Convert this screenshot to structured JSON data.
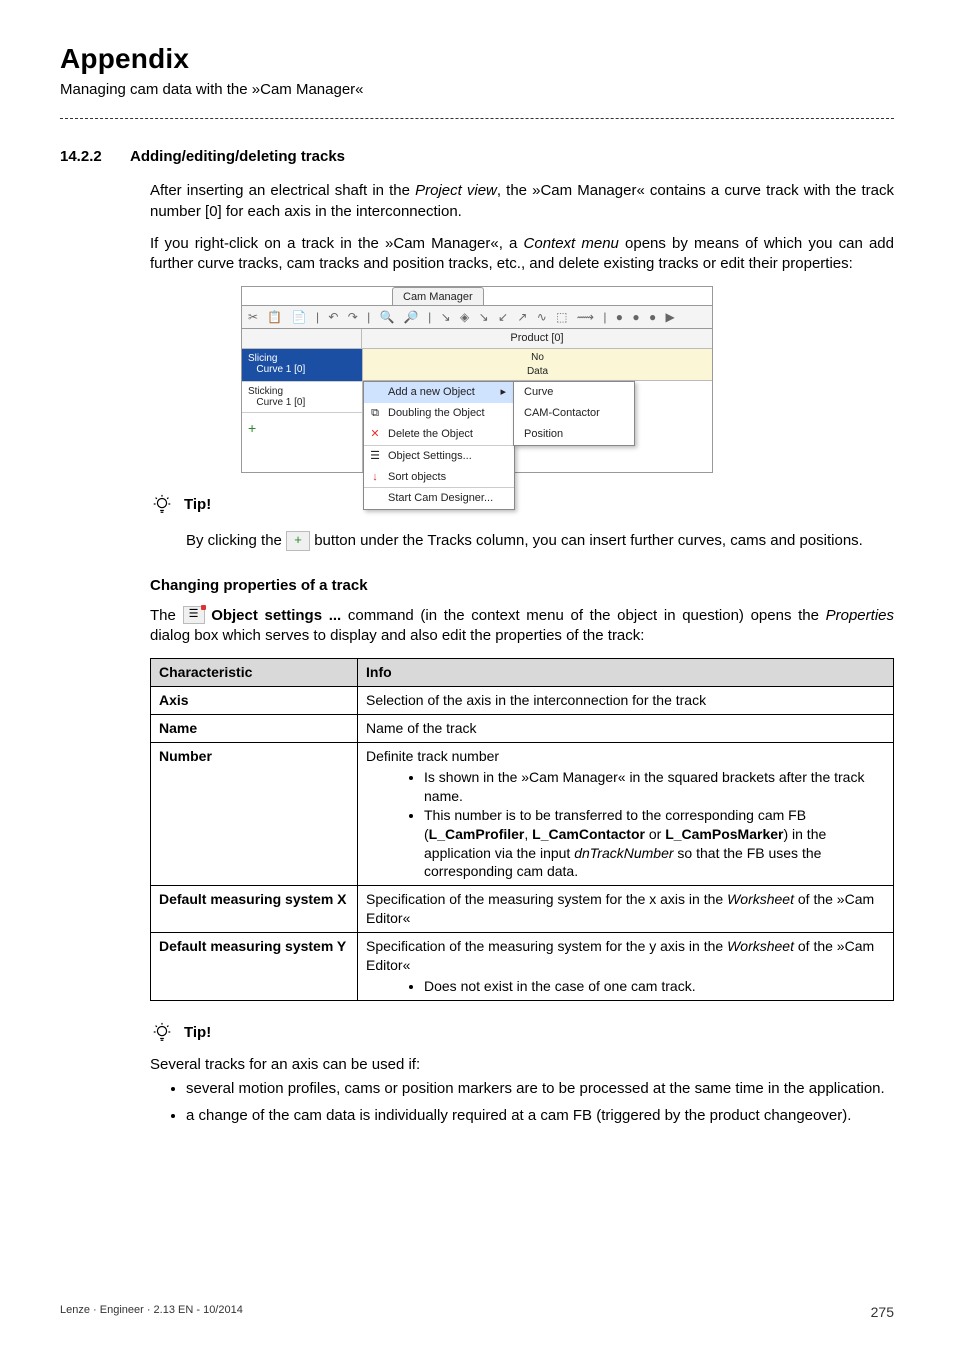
{
  "header": {
    "title": "Appendix",
    "subtitle": "Managing cam data with the »Cam Manager«"
  },
  "section": {
    "number": "14.2.2",
    "title": "Adding/editing/deleting tracks",
    "para1_a": "After inserting an electrical shaft in the ",
    "para1_b": "Project view",
    "para1_c": ", the »Cam Manager« contains a curve track with the track number [0] for each axis in the interconnection.",
    "para2_a": "If you right-click on a track in the »Cam Manager«, a ",
    "para2_b": "Context menu",
    "para2_c": " opens by means of which you can add further curve tracks, cam tracks and position tracks, etc., and delete existing tracks or edit their properties:"
  },
  "shot": {
    "tab": "Cam Manager",
    "toolbar_glyphs": "✂ 📋 📄 | ↶ ↷ | 🔍 🔎 | ↘ ◈ ↘ ↙ ↗ ∿ ⬚ ⟿ | ● ● ● ▶",
    "product_header": "Product [0]",
    "track1_line1": "Slicing",
    "track1_line2": "Curve 1 [0]",
    "track2_line1": "Sticking",
    "track2_line2": "Curve 1 [0]",
    "no_data": "No\nData",
    "plus": "+",
    "ctx": {
      "add": "Add a new Object",
      "double": "Doubling the Object",
      "delete": "Delete the Object",
      "settings": "Object Settings...",
      "sort": "Sort objects",
      "start": "Start Cam Designer...",
      "sub_curve": "Curve",
      "sub_cam": "CAM-Contactor",
      "sub_pos": "Position"
    }
  },
  "tip1": {
    "label": "Tip!",
    "body_a": "By clicking the ",
    "body_b": " button under the Tracks column, you can insert further curves, cams and positions."
  },
  "change_heading": "Changing properties of a track",
  "change_para": {
    "a": "The ",
    "b": "Object settings ...",
    "c": " command (in the context menu of the object in question) opens the ",
    "d": "Properties",
    "e": " dialog box which serves to display and also edit the properties of the track:"
  },
  "table": {
    "h1": "Characteristic",
    "h2": "Info",
    "rows": [
      {
        "c": "Axis",
        "i": "Selection of the axis in the interconnection for the track"
      },
      {
        "c": "Name",
        "i": "Name of the track"
      },
      {
        "c": "Number",
        "i_main": "Definite track number",
        "bullets": [
          "Is shown in the »Cam Manager« in the squared brackets after the track name.",
          "This number is to be transferred to the corresponding cam FB (<b>L_CamProfiler</b>, <b>L_CamContactor</b> or <b>L_CamPosMarker</b>) in the application via the input <i>dnTrackNumber</i> so that the FB uses the corresponding cam data."
        ]
      },
      {
        "c": "Default measuring system X",
        "i": "Specification of the measuring system for the x axis in the <i>Worksheet</i> of the »Cam Editor«"
      },
      {
        "c": "Default measuring system Y",
        "i_main": "Specification of the measuring system for the y axis in the <i>Worksheet</i> of the »Cam Editor«",
        "bullets": [
          "Does not exist in the case of one cam track."
        ]
      }
    ]
  },
  "tip2": {
    "label": "Tip!",
    "lead": "Several tracks for an axis can be used if:",
    "bullets": [
      "several motion profiles, cams or position markers are to be processed at the same time in the application.",
      "a change of the cam data is individually required at a cam FB (triggered by the product changeover)."
    ]
  },
  "footer": {
    "left": "Lenze · Engineer · 2.13 EN - 10/2014",
    "right": "275"
  }
}
